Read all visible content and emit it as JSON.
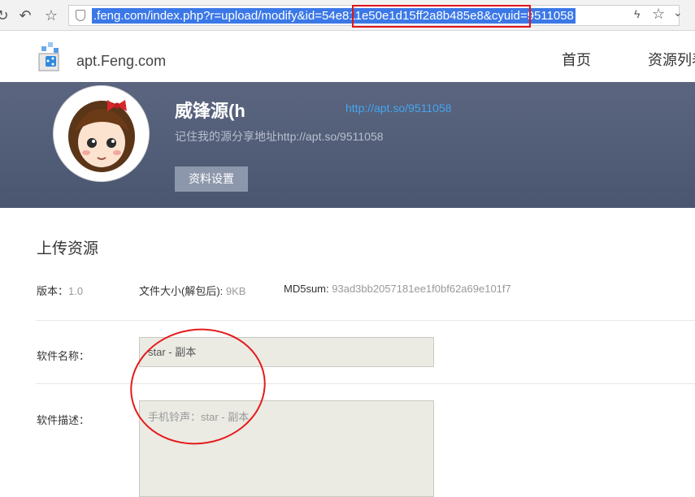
{
  "browser": {
    "url": ".feng.com/index.php?r=upload/modify&id=54e811e50e1d15ff2a8b485e8&cyuid=9511058",
    "refresh_icon": "refresh-icon",
    "back_icon": "undo-icon",
    "star_icon": "star-icon"
  },
  "header": {
    "logo_text": "apt.Feng.com",
    "nav": [
      "首页",
      "资源列表"
    ]
  },
  "profile": {
    "username": "威锋源(h",
    "link": "http://apt.so/9511058",
    "share_text": "记住我的源分享地址http://apt.so/9511058",
    "settings_label": "资料设置"
  },
  "content": {
    "section_title": "上传资源",
    "version_label": "版本：",
    "version_value": "1.0",
    "size_label": "文件大小(解包后):",
    "size_value": "9KB",
    "md5_label": "MD5sum:",
    "md5_value": "93ad3bb2057181ee1f0bf62a69e101f7",
    "name_label": "软件名称：",
    "name_value": "star - 副本",
    "desc_label": "软件描述：",
    "desc_value": "手机铃声：star - 副本"
  },
  "colors": {
    "profile_bg": "#4f5a73",
    "accent": "#44a5f0",
    "annotation": "#e51a1a"
  }
}
